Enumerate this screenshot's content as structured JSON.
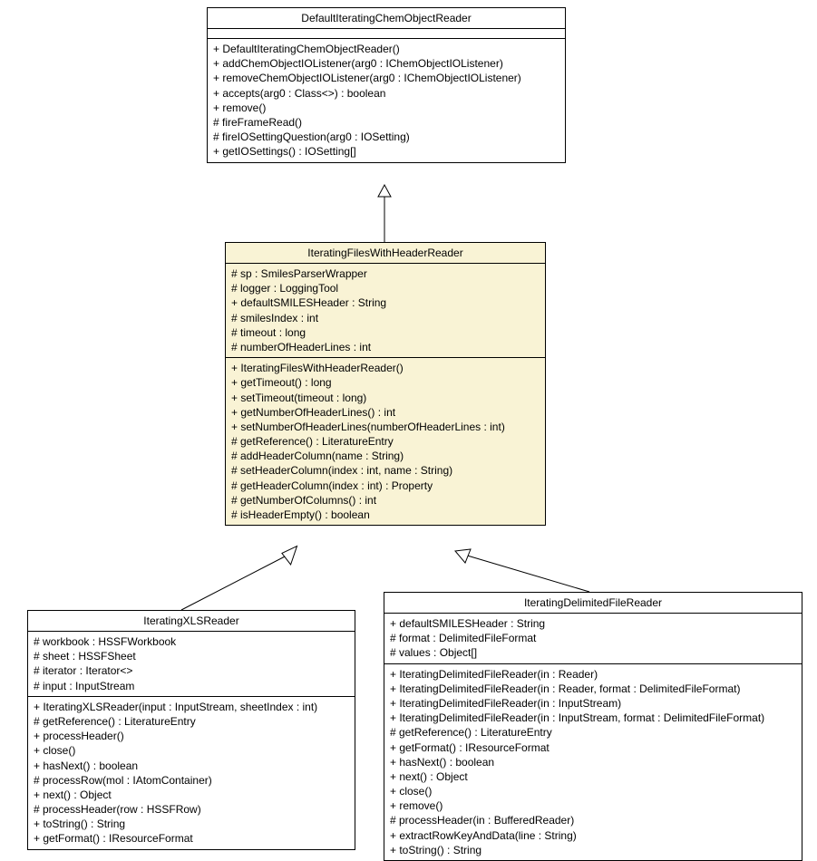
{
  "classes": {
    "default_reader": {
      "name": "DefaultIteratingChemObjectReader",
      "attributes": [],
      "methods": [
        "+ DefaultIteratingChemObjectReader()",
        "+ addChemObjectIOListener(arg0 : IChemObjectIOListener)",
        "+ removeChemObjectIOListener(arg0 : IChemObjectIOListener)",
        "+ accepts(arg0 : Class<>) : boolean",
        "+ remove()",
        "# fireFrameRead()",
        "# fireIOSettingQuestion(arg0 : IOSetting)",
        "+ getIOSettings() : IOSetting[]"
      ]
    },
    "header_reader": {
      "name": "IteratingFilesWithHeaderReader",
      "attributes": [
        "# sp : SmilesParserWrapper",
        "# logger : LoggingTool",
        "+ defaultSMILESHeader : String",
        "# smilesIndex : int",
        "# timeout : long",
        "# numberOfHeaderLines : int"
      ],
      "methods": [
        "+ IteratingFilesWithHeaderReader()",
        "+ getTimeout() : long",
        "+ setTimeout(timeout : long)",
        "+ getNumberOfHeaderLines() : int",
        "+ setNumberOfHeaderLines(numberOfHeaderLines : int)",
        "# getReference() : LiteratureEntry",
        "# addHeaderColumn(name : String)",
        "# setHeaderColumn(index : int, name : String)",
        "# getHeaderColumn(index : int) : Property",
        "# getNumberOfColumns() : int",
        "# isHeaderEmpty() : boolean"
      ]
    },
    "xls_reader": {
      "name": "IteratingXLSReader",
      "attributes": [
        "# workbook : HSSFWorkbook",
        "# sheet : HSSFSheet",
        "# iterator : Iterator<>",
        "# input : InputStream"
      ],
      "methods": [
        "+ IteratingXLSReader(input : InputStream, sheetIndex : int)",
        "# getReference() : LiteratureEntry",
        "+ processHeader()",
        "+ close()",
        "+ hasNext() : boolean",
        "# processRow(mol : IAtomContainer)",
        "+ next() : Object",
        "# processHeader(row : HSSFRow)",
        "+ toString() : String",
        "+ getFormat() : IResourceFormat"
      ]
    },
    "delimited_reader": {
      "name": "IteratingDelimitedFileReader",
      "attributes": [
        "+ defaultSMILESHeader : String",
        "# format : DelimitedFileFormat",
        "# values : Object[]"
      ],
      "methods": [
        "+ IteratingDelimitedFileReader(in : Reader)",
        "+ IteratingDelimitedFileReader(in : Reader, format : DelimitedFileFormat)",
        "+ IteratingDelimitedFileReader(in : InputStream)",
        "+ IteratingDelimitedFileReader(in : InputStream, format : DelimitedFileFormat)",
        "# getReference() : LiteratureEntry",
        "+ getFormat() : IResourceFormat",
        "+ hasNext() : boolean",
        "+ next() : Object",
        "+ close()",
        "+ remove()",
        "# processHeader(in : BufferedReader)",
        "+ extractRowKeyAndData(line : String)",
        "+ toString() : String"
      ]
    }
  }
}
